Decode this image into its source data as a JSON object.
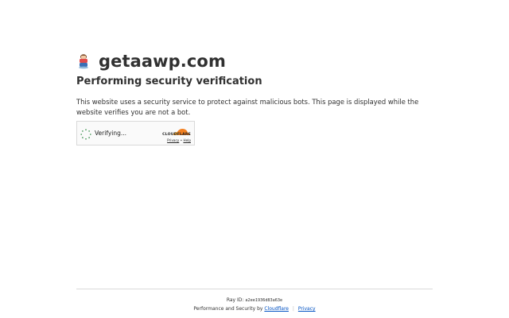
{
  "site": {
    "title": "getaawp.com",
    "icon": "site-favicon-icon"
  },
  "main": {
    "heading": "Performing security verification",
    "description": "This website uses a security service to protect against malicious bots. This page is displayed while the website verifies you are not a bot."
  },
  "widget": {
    "status": "Verifying...",
    "brand": "CLOUDFLARE",
    "privacy_link": "Privacy",
    "separator": "•",
    "help_link": "Help",
    "brand_color": "#f38020"
  },
  "footer": {
    "ray_label": "Ray ID:",
    "ray_id": "a2ee1936d83a63e",
    "performance_text": "Performance and Security by",
    "cloudflare_link": "Cloudflare",
    "divider": "|",
    "privacy_link": "Privacy",
    "link_color": "#0051c3"
  }
}
